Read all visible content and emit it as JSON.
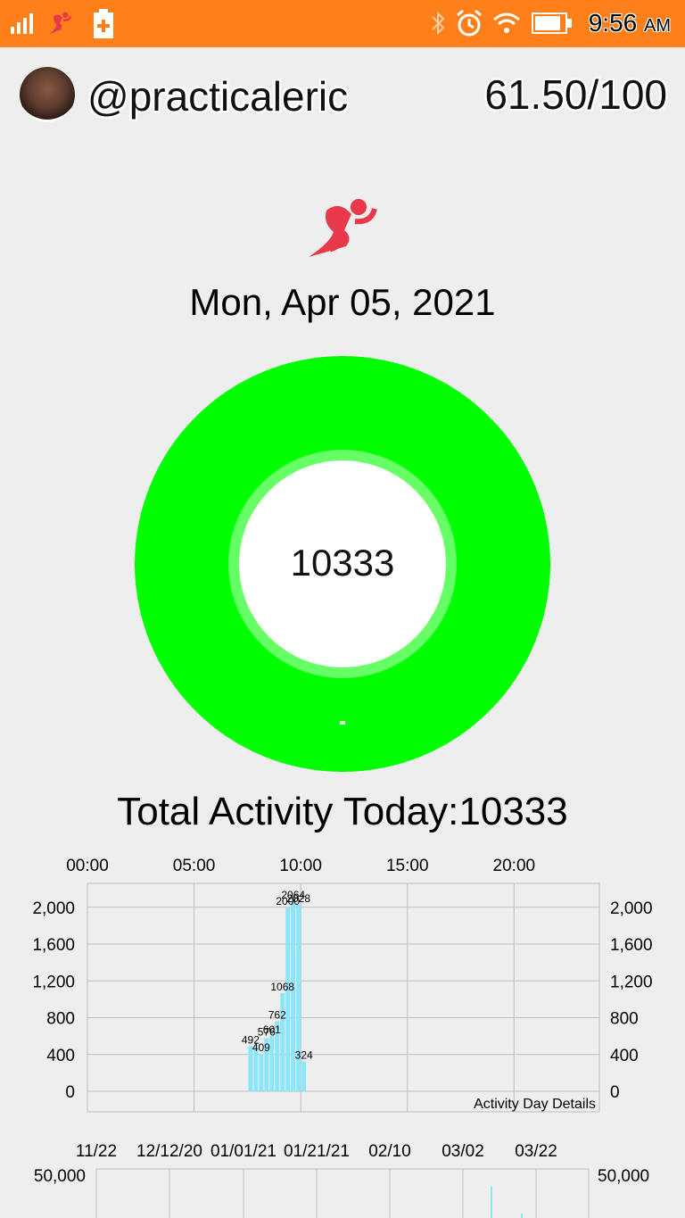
{
  "status_bar": {
    "icons": [
      "signal-bars-icon",
      "runner-notification-icon",
      "battery-saver-icon",
      "bluetooth-icon",
      "alarm-icon",
      "wifi-icon",
      "battery-icon"
    ],
    "time": "9:56",
    "ampm": "AM"
  },
  "profile": {
    "username": "@practicaleric",
    "score": "61.50/100"
  },
  "main": {
    "date": "Mon, Apr 05, 2021",
    "ring_value": "10333",
    "total_label": "Total Activity Today:10333"
  },
  "colors": {
    "status_bar": "#ff7f1a",
    "ring": "#00ff00",
    "ring_inner_border": "#66ff66",
    "bar": "#8ce6fa",
    "runner": "#e8394a"
  },
  "chart_data": [
    {
      "type": "bar",
      "x_top_ticks": [
        "00:00",
        "05:00",
        "10:00",
        "15:00",
        "20:00"
      ],
      "y_ticks": [
        "0",
        "400",
        "800",
        "1,200",
        "1,600",
        "2,000"
      ],
      "ylim": [
        0,
        2260
      ],
      "xlim_hours": [
        0,
        24
      ],
      "grid": true,
      "caption": "Activity Day Details",
      "bars": [
        {
          "hour": 7.75,
          "value": 492,
          "label": "492"
        },
        {
          "hour": 8.0,
          "value": 500,
          "label": ""
        },
        {
          "hour": 8.25,
          "value": 409,
          "label": "409"
        },
        {
          "hour": 8.5,
          "value": 576,
          "label": "576"
        },
        {
          "hour": 8.75,
          "value": 601,
          "label": "601"
        },
        {
          "hour": 9.0,
          "value": 762,
          "label": "762"
        },
        {
          "hour": 9.25,
          "value": 1068,
          "label": "1068"
        },
        {
          "hour": 9.5,
          "value": 2000,
          "label": "2000"
        },
        {
          "hour": 9.75,
          "value": 2064,
          "label": "2064"
        },
        {
          "hour": 10.0,
          "value": 2028,
          "label": "2028"
        },
        {
          "hour": 10.25,
          "value": 324,
          "label": "324"
        }
      ]
    },
    {
      "type": "bar",
      "x_top_ticks": [
        "11/22",
        "12/12/20",
        "01/01/21",
        "01/21/21",
        "02/10",
        "03/02",
        "03/22"
      ],
      "y_ticks": [
        "50,000"
      ],
      "grid": true
    }
  ]
}
